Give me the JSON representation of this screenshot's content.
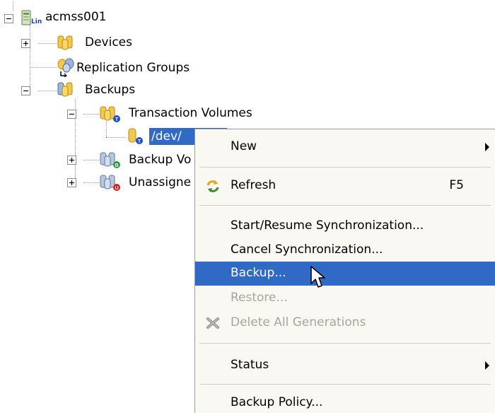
{
  "tree": {
    "root": {
      "label": "acmss001",
      "badge": "Lin",
      "expander": "-"
    },
    "nodes": [
      {
        "key": "devices",
        "label": "Devices",
        "expander": "+"
      },
      {
        "key": "replication",
        "label": "Replication Groups",
        "expander": ""
      },
      {
        "key": "backups",
        "label": "Backups",
        "expander": "-"
      },
      {
        "key": "transaction",
        "label": "Transaction Volumes",
        "expander": "-",
        "badge": "T"
      },
      {
        "key": "dev",
        "label": "/dev/",
        "selected": true,
        "badge": "T"
      },
      {
        "key": "backup_vol",
        "label": "Backup Vo",
        "expander": "+",
        "badge": "B"
      },
      {
        "key": "unassigned",
        "label": "Unassigne",
        "expander": "+",
        "badge": "U"
      }
    ]
  },
  "context_menu": {
    "items": [
      {
        "label": "New",
        "submenu": true
      },
      {
        "label": "Refresh",
        "shortcut": "F5",
        "icon": "refresh-icon"
      },
      {
        "label": "Start/Resume Synchronization..."
      },
      {
        "label": "Cancel Synchronization..."
      },
      {
        "label": "Backup...",
        "highlighted": true
      },
      {
        "label": "Restore...",
        "disabled": true
      },
      {
        "label": "Delete All Generations",
        "disabled": true,
        "icon": "delete-x-icon"
      },
      {
        "label": "Status",
        "submenu": true
      },
      {
        "label": "Backup Policy..."
      }
    ]
  },
  "colors": {
    "selection": "#316ac5",
    "menu_background": "#f9f8f3",
    "disabled_text": "#a7a69c",
    "folder_yellow": "#f2c94c"
  }
}
